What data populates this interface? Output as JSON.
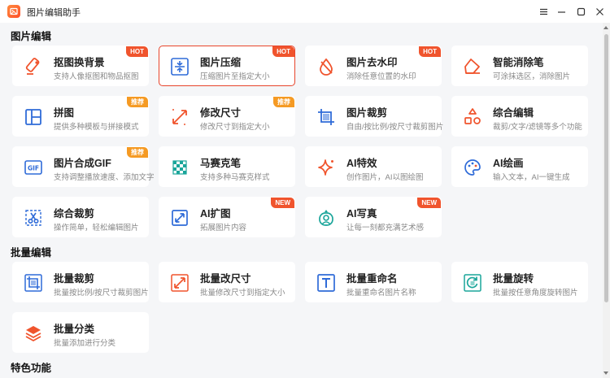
{
  "window": {
    "title": "图片编辑助手"
  },
  "sections": [
    {
      "title": "图片编辑"
    },
    {
      "title": "批量编辑"
    },
    {
      "title": "特色功能"
    }
  ],
  "cards": [
    {
      "name": "抠图换背景",
      "desc": "支持人像抠图和物品抠图",
      "badge": "HOT",
      "icon": "eraser-icon"
    },
    {
      "name": "图片压缩",
      "desc": "压缩图片至指定大小",
      "badge": "HOT",
      "icon": "compress-icon"
    },
    {
      "name": "图片去水印",
      "desc": "消除任意位置的水印",
      "badge": "HOT",
      "icon": "drop-icon"
    },
    {
      "name": "智能消除笔",
      "desc": "可涂抹选区，消除图片",
      "badge": "",
      "icon": "eraser-pen-icon"
    },
    {
      "name": "拼图",
      "desc": "提供多种模板与拼接模式",
      "badge": "推荐",
      "icon": "collage-icon"
    },
    {
      "name": "修改尺寸",
      "desc": "修改尺寸到指定大小",
      "badge": "推荐",
      "icon": "resize-icon"
    },
    {
      "name": "图片裁剪",
      "desc": "自由/按比例/按尺寸裁剪图片",
      "badge": "",
      "icon": "crop-icon"
    },
    {
      "name": "综合编辑",
      "desc": "裁剪/文字/滤镜等多个功能",
      "badge": "",
      "icon": "shapes-icon"
    },
    {
      "name": "图片合成GIF",
      "desc": "支持调整播放速度、添加文字",
      "badge": "推荐",
      "icon": "gif-icon"
    },
    {
      "name": "马赛克笔",
      "desc": "支持多种马赛克样式",
      "badge": "",
      "icon": "mosaic-icon"
    },
    {
      "name": "AI特效",
      "desc": "创作图片，AI以图绘图",
      "badge": "",
      "icon": "sparkle-icon"
    },
    {
      "name": "AI绘画",
      "desc": "输入文本，AI一键生成",
      "badge": "",
      "icon": "palette-icon"
    },
    {
      "name": "综合裁剪",
      "desc": "操作简单，轻松编辑图片",
      "badge": "",
      "icon": "scissors-icon"
    },
    {
      "name": "AI扩图",
      "desc": "拓展图片内容",
      "badge": "NEW",
      "icon": "expand-icon"
    },
    {
      "name": "AI写真",
      "desc": "让每一刻都充满艺术感",
      "badge": "NEW",
      "icon": "portrait-icon"
    },
    {
      "name": "批量裁剪",
      "desc": "批量按比例/按尺寸裁剪图片",
      "badge": "",
      "icon": "batch-crop-icon"
    },
    {
      "name": "批量改尺寸",
      "desc": "批量修改尺寸到指定大小",
      "badge": "",
      "icon": "batch-resize-icon"
    },
    {
      "name": "批量重命名",
      "desc": "批量重命名图片名称",
      "badge": "",
      "icon": "rename-icon"
    },
    {
      "name": "批量旋转",
      "desc": "批量按任意角度旋转图片",
      "badge": "",
      "icon": "rotate-icon"
    },
    {
      "name": "批量分类",
      "desc": "批量添加进行分类",
      "badge": "",
      "icon": "layers-icon"
    }
  ],
  "colors": {
    "accent": "#f0542d",
    "recommend": "#f59a23",
    "blue": "#2f6bd8",
    "selected_border": "#e8452c"
  }
}
